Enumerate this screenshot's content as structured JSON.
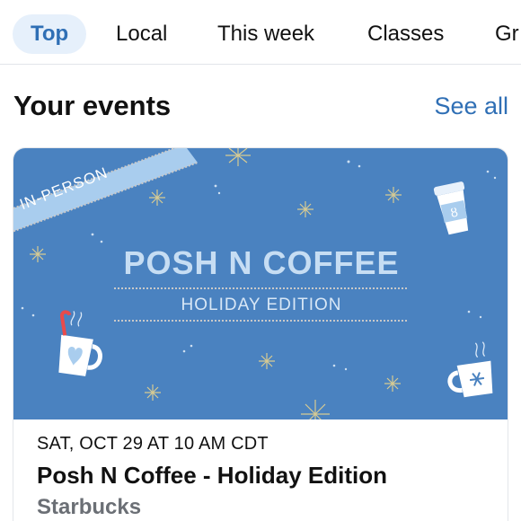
{
  "tabs": [
    {
      "label": "Top",
      "active": true
    },
    {
      "label": "Local",
      "active": false
    },
    {
      "label": "This week",
      "active": false
    },
    {
      "label": "Classes",
      "active": false
    },
    {
      "label": "Gr",
      "active": false
    }
  ],
  "section": {
    "title": "Your events",
    "see_all": "See all"
  },
  "event": {
    "badge": "IN-PERSON",
    "banner_title": "POSH N COFFEE",
    "banner_subtitle": "HOLIDAY EDITION",
    "date": "SAT, OCT 29 AT 10 AM CDT",
    "name": "Posh N Coffee - Holiday Edition",
    "venue": "Starbucks"
  },
  "colors": {
    "accent": "#2f6fb5",
    "active_tab_bg": "#e6f0fb",
    "banner_bg": "#4a82c0",
    "badge_bg": "#a9cdee",
    "secondary_text": "#6b6f75"
  },
  "icons": [
    "coffee-cup-icon",
    "mug-icon",
    "snowflake-mug-icon",
    "sparkle-icon"
  ]
}
